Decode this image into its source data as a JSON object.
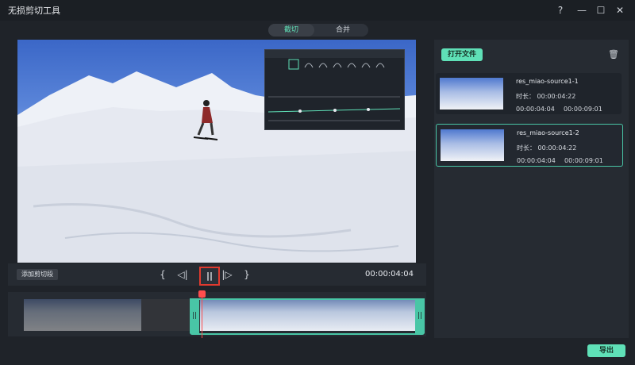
{
  "app": {
    "title": "无损剪切工具"
  },
  "window": {
    "help": "?",
    "minimize": "—",
    "maximize": "☐",
    "close": "✕"
  },
  "tabs": [
    {
      "label": "截切",
      "active": true
    },
    {
      "label": "合并",
      "active": false
    }
  ],
  "controls": {
    "add_segment_label": "添加剪切段",
    "set_in": "{",
    "prev_frame": "◁|",
    "pause": "||",
    "next_frame": "|▷",
    "set_out": "}",
    "current_time": "00:00:04:04"
  },
  "file_panel": {
    "open_button": "打开文件",
    "items": [
      {
        "name": "res_miao-source1-1",
        "duration": "时长： 00:00:04:22",
        "start": "00:00:04:04",
        "end": "00:00:09:01",
        "active": false
      },
      {
        "name": "res_miao-source1-2",
        "duration": "时长： 00:00:04:22",
        "start": "00:00:04:04",
        "end": "00:00:09:01",
        "active": true
      }
    ]
  },
  "timeline": {
    "handle_left": "||",
    "handle_right": "||"
  },
  "export_button": "导出",
  "colors": {
    "accent": "#5fe0b7",
    "accent_border": "#49c6a6",
    "background": "#1f2329",
    "panel": "#262b32",
    "playhead": "#ff4d4d"
  }
}
